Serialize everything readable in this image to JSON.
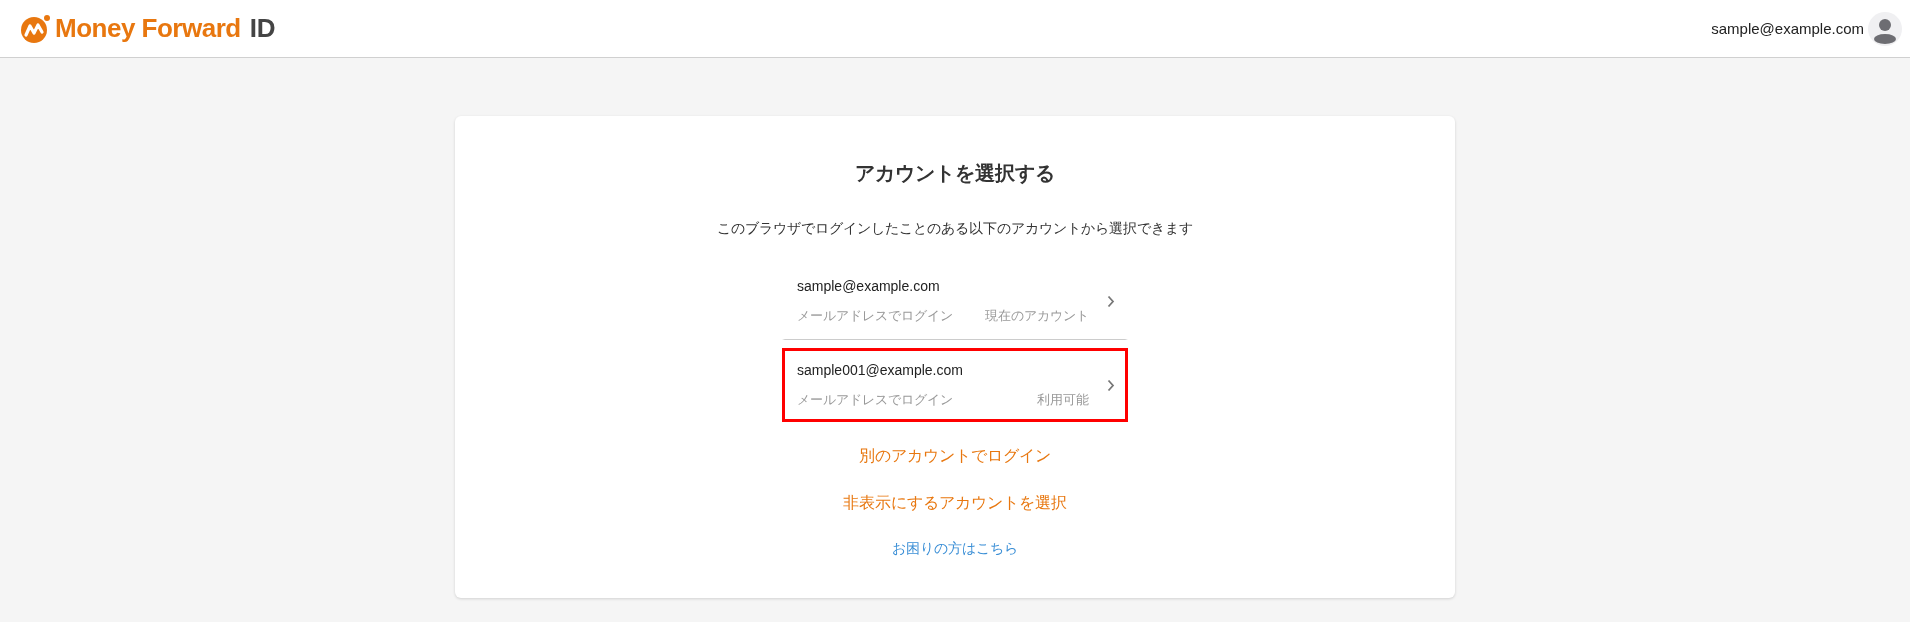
{
  "header": {
    "logo": {
      "brand": "Money Forward",
      "suffix": "ID"
    },
    "user_email": "sample@example.com"
  },
  "card": {
    "title": "アカウントを選択する",
    "description": "このブラウザでログインしたことのある以下のアカウントから選択できます",
    "accounts": [
      {
        "email": "sample@example.com",
        "method": "メールアドレスでログイン",
        "status": "現在のアカウント",
        "highlighted": false
      },
      {
        "email": "sample001@example.com",
        "method": "メールアドレスでログイン",
        "status": "利用可能",
        "highlighted": true
      }
    ],
    "links": [
      {
        "label": "別のアカウントでログイン",
        "kind": "action"
      },
      {
        "label": "非表示にするアカウントを選択",
        "kind": "action"
      },
      {
        "label": "お困りの方はこちら",
        "kind": "help"
      }
    ]
  }
}
